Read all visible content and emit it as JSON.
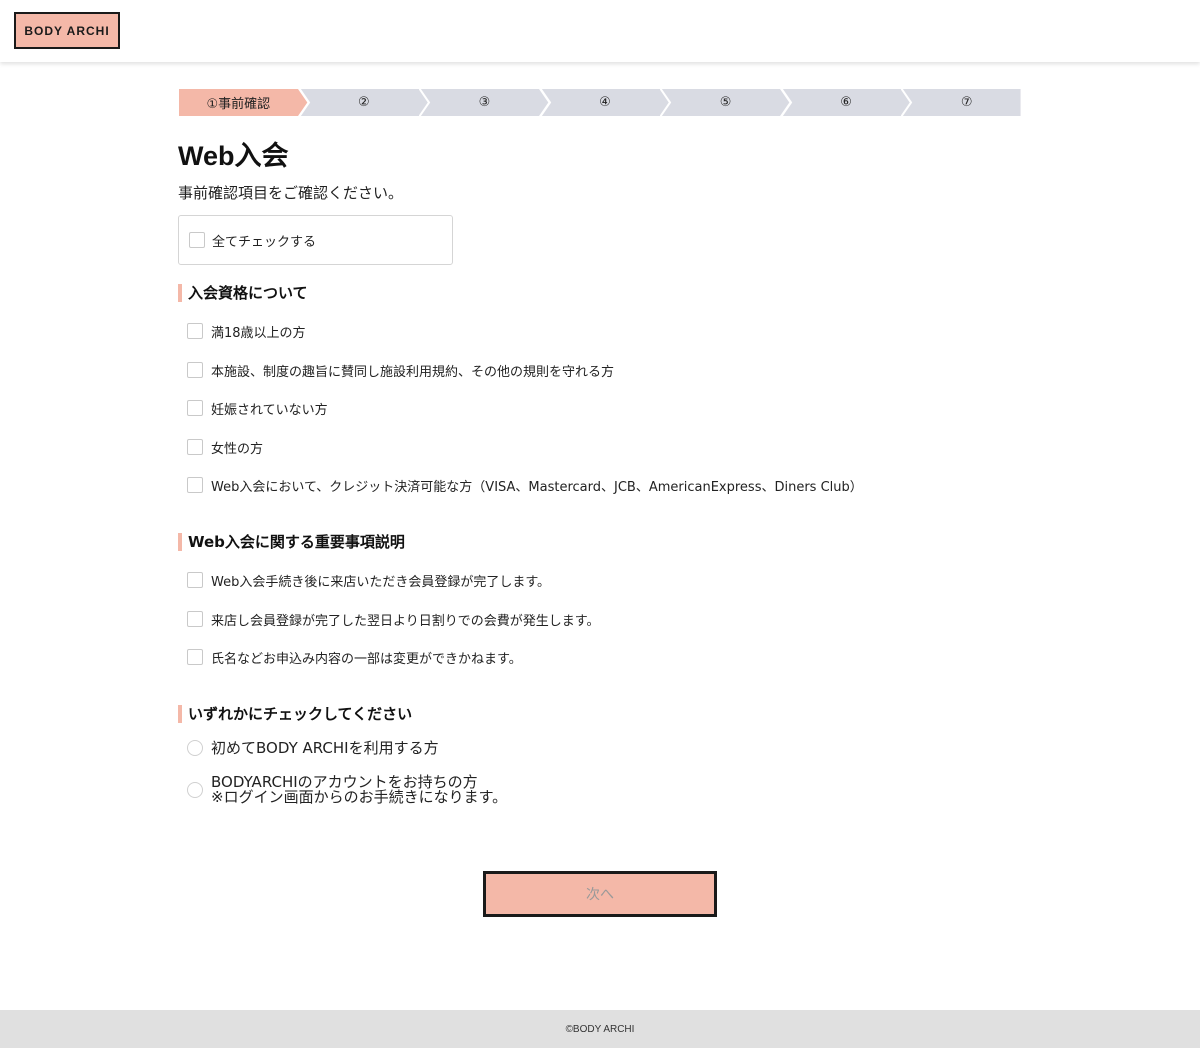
{
  "header": {
    "logo_text": "BODY ARCHI"
  },
  "steps": [
    {
      "label": "①事前確認",
      "active": true
    },
    {
      "label": "②",
      "active": false
    },
    {
      "label": "③",
      "active": false
    },
    {
      "label": "④",
      "active": false
    },
    {
      "label": "⑤",
      "active": false
    },
    {
      "label": "⑥",
      "active": false
    },
    {
      "label": "⑦",
      "active": false
    }
  ],
  "colors": {
    "accent": "#f4b8a8",
    "step_inactive": "#d9dbe3",
    "footer_bg": "#e0e0e0"
  },
  "page": {
    "title": "Web入会",
    "subtitle": "事前確認項目をご確認ください。",
    "check_all_label": "全てチェックする"
  },
  "eligibility": {
    "title": "入会資格について",
    "items": [
      "満18歳以上の方",
      "本施設、制度の趣旨に賛同し施設利用規約、その他の規則を守れる方",
      "妊娠されていない方",
      "女性の方",
      "Web入会において、クレジット決済可能な方（VISA、Mastercard、JCB、AmericanExpress、Diners Club）"
    ]
  },
  "important": {
    "title": "Web入会に関する重要事項説明",
    "items": [
      "Web入会手続き後に来店いただき会員登録が完了します。",
      "来店し会員登録が完了した翌日より日割りでの会費が発生します。",
      "氏名などお申込み内容の一部は変更ができかねます。"
    ]
  },
  "choice": {
    "title": "いずれかにチェックしてください",
    "option1": "初めてBODY ARCHIを利用する方",
    "option2_line1": "BODYARCHIのアカウントをお持ちの方",
    "option2_line2": "※ログイン画面からのお手続きになります。"
  },
  "next_button": "次へ",
  "footer": {
    "copyright": "©BODY ARCHI"
  }
}
